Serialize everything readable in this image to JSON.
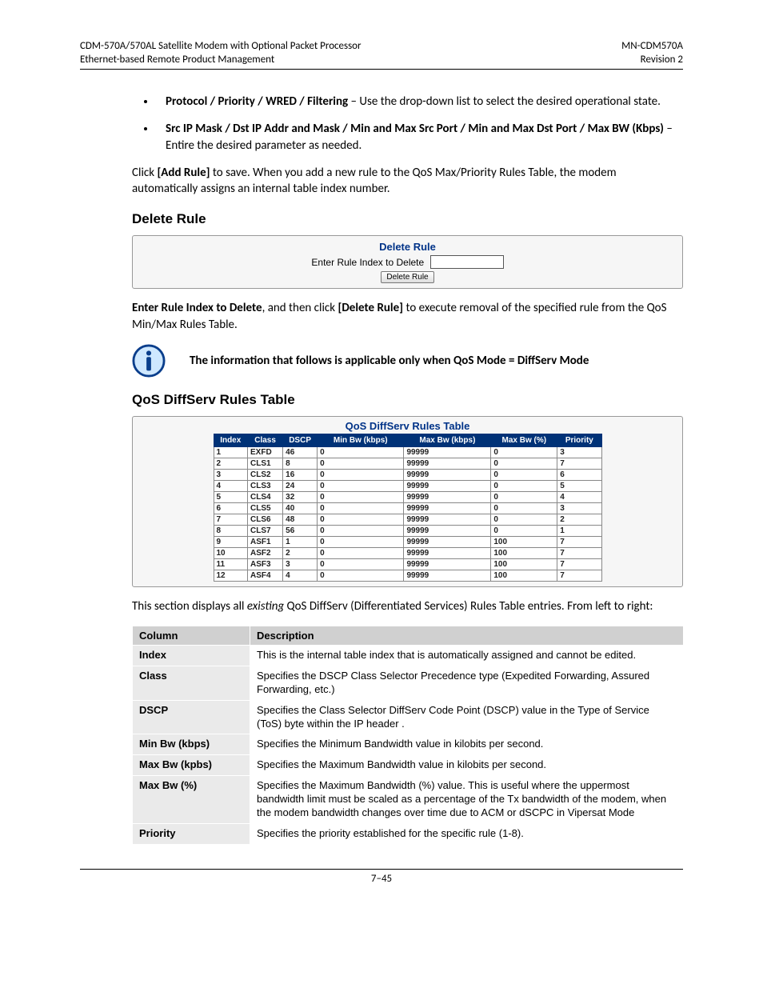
{
  "header": {
    "left1": "CDM-570A/570AL Satellite Modem with Optional Packet Processor",
    "left2": "Ethernet-based Remote Product Management",
    "right1": "MN-CDM570A",
    "right2": "Revision 2"
  },
  "bullets": [
    {
      "bold": "Protocol / Priority / WRED / Filtering",
      "rest": " – Use the drop-down list to select the desired operational state."
    },
    {
      "bold": "Src IP Mask / Dst IP Addr  and Mask / Min and Max Src Port / Min and Max Dst Port / Max BW (Kbps)",
      "rest": " – Entire the desired parameter as needed."
    }
  ],
  "add_para": {
    "pre": "Click ",
    "b1": "[Add Rule]",
    "rest": " to save. When you add a new rule to the QoS Max/Priority Rules Table, the modem automatically assigns an internal table index number."
  },
  "delete_rule_heading": "Delete Rule",
  "delete_box": {
    "title": "Delete Rule",
    "label": "Enter Rule Index to Delete",
    "button": "Delete Rule"
  },
  "delete_para": {
    "b1": "Enter Rule Index to Delete",
    "mid": ", and then click ",
    "b2": "[Delete Rule]",
    "rest": " to execute removal of the specified rule from the QoS Min/Max Rules Table."
  },
  "info_text": "The information that follows is applicable only when QoS Mode = DiffServ Mode",
  "qos_heading": "QoS DiffServ Rules Table",
  "diffserv": {
    "title": "QoS DiffServ Rules Table",
    "headers": [
      "Index",
      "Class",
      "DSCP",
      "Min Bw (kbps)",
      "Max Bw (kbps)",
      "Max Bw (%)",
      "Priority"
    ],
    "rows": [
      [
        "1",
        "EXFD",
        "46",
        "0",
        "99999",
        "0",
        "3"
      ],
      [
        "2",
        "CLS1",
        "8",
        "0",
        "99999",
        "0",
        "7"
      ],
      [
        "3",
        "CLS2",
        "16",
        "0",
        "99999",
        "0",
        "6"
      ],
      [
        "4",
        "CLS3",
        "24",
        "0",
        "99999",
        "0",
        "5"
      ],
      [
        "5",
        "CLS4",
        "32",
        "0",
        "99999",
        "0",
        "4"
      ],
      [
        "6",
        "CLS5",
        "40",
        "0",
        "99999",
        "0",
        "3"
      ],
      [
        "7",
        "CLS6",
        "48",
        "0",
        "99999",
        "0",
        "2"
      ],
      [
        "8",
        "CLS7",
        "56",
        "0",
        "99999",
        "0",
        "1"
      ],
      [
        "9",
        "ASF1",
        "1",
        "0",
        "99999",
        "100",
        "7"
      ],
      [
        "10",
        "ASF2",
        "2",
        "0",
        "99999",
        "100",
        "7"
      ],
      [
        "11",
        "ASF3",
        "3",
        "0",
        "99999",
        "100",
        "7"
      ],
      [
        "12",
        "ASF4",
        "4",
        "0",
        "99999",
        "100",
        "7"
      ]
    ]
  },
  "desc_intro": {
    "pre": "This section displays all ",
    "italic": "existing",
    "rest": " QoS DiffServ (Differentiated Services) Rules Table entries. From left to right:"
  },
  "desc_table": {
    "h1": "Column",
    "h2": "Description",
    "rows": [
      [
        "Index",
        "This is the internal table index that is automatically assigned and cannot be edited."
      ],
      [
        "Class",
        "Specifies the DSCP Class Selector Precedence type (Expedited Forwarding, Assured Forwarding, etc.)"
      ],
      [
        "DSCP",
        "Specifies the Class Selector DiffServ Code Point (DSCP) value in the Type of Service (ToS) byte within the IP header ."
      ],
      [
        "Min Bw (kbps)",
        "Specifies the Minimum Bandwidth value in kilobits per second."
      ],
      [
        "Max Bw (kpbs)",
        "Specifies the Maximum Bandwidth value in kilobits per second."
      ],
      [
        "Max Bw (%)",
        "Specifies the Maximum Bandwidth (%) value. This is useful where the uppermost bandwidth limit  must be scaled as a percentage of the Tx bandwidth of the modem, when the modem bandwidth changes over time due to ACM or dSCPC in Vipersat Mode"
      ],
      [
        "Priority",
        "Specifies the priority established for the specific rule (1-8)."
      ]
    ]
  },
  "page_num": "7–45"
}
